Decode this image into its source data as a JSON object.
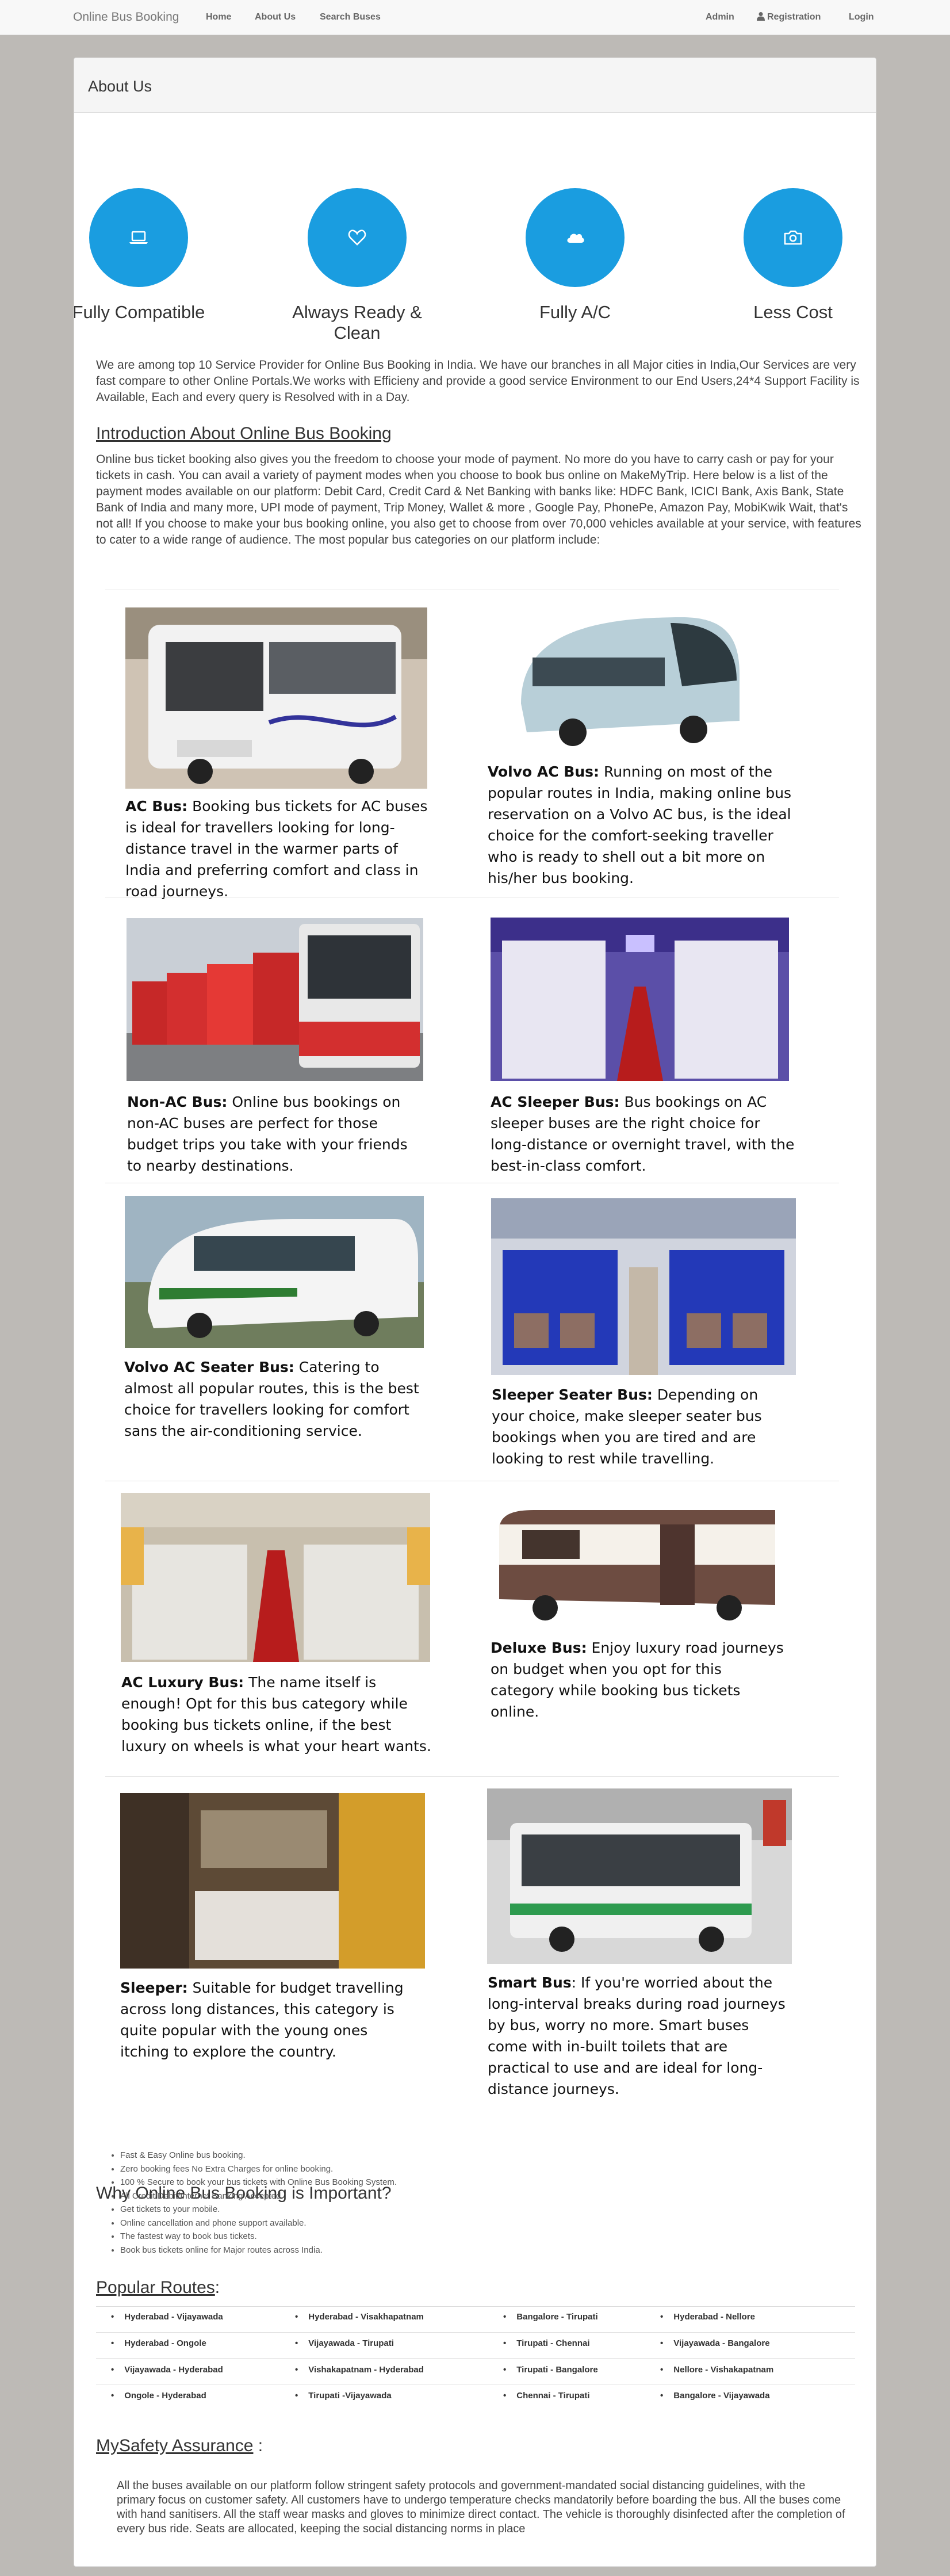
{
  "nav": {
    "brand": "Online Bus Booking",
    "home": "Home",
    "about": "About Us",
    "search": "Search Buses",
    "admin": "Admin",
    "registration": "Registration",
    "login": "Login"
  },
  "panel": {
    "title": "About Us"
  },
  "features": [
    {
      "label": "Fully Compatible",
      "icon": "laptop-icon"
    },
    {
      "label": "Always Ready & Clean",
      "icon": "heart-icon"
    },
    {
      "label": "Fully A/C",
      "icon": "cloud-icon"
    },
    {
      "label": "Less Cost",
      "icon": "camera-icon"
    }
  ],
  "colors": {
    "accent": "#1a9de0",
    "background": "#bdbab6"
  },
  "intro_paragraph": "We are among top 10 Service Provider for Online Bus Booking in India. We have our branches in all Major cities in India,Our Services are very fast compare to other Online Portals.We works with Efficieny and provide a good service Environment to our End Users,24*4 Support Facility is Available, Each and every query is Resolved with in a Day.",
  "introduction": {
    "heading": "Introduction About Online Bus Booking",
    "text": "Online bus ticket booking also gives you the freedom to choose your mode of payment. No more do you have to carry cash or pay for your tickets in cash. You can avail a variety of payment modes when you choose to book bus online on MakeMyTrip. Here below is a list of the payment modes available on our platform: Debit Card, Credit Card & Net Banking with banks like: HDFC Bank, ICICI Bank, Axis Bank, State Bank of India and many more, UPI mode of payment, Trip Money, Wallet & more , Google Pay, PhonePe, Amazon Pay, MobiKwik Wait, that's not all! If you choose to make your bus booking online, you also get to choose from over 70,000 vehicles available at your service, with features to cater to a wide range of audience. The most popular bus categories on our platform include:"
  },
  "buses": [
    {
      "name": "AC Bus:",
      "desc": " Booking bus tickets for AC buses is ideal for travellers looking for long-distance travel in the warmer parts of India and preferring comfort and class in road journeys."
    },
    {
      "name": "Volvo AC Bus:",
      "desc": " Running on most of the popular routes in India, making online bus reservation on a Volvo AC bus, is the ideal choice for the comfort-seeking traveller who is ready to shell out a bit more on his/her bus booking."
    },
    {
      "name": "Non-AC Bus:",
      "desc": " Online bus bookings on non-AC buses are perfect for those budget trips you take with your friends to nearby destinations."
    },
    {
      "name": "AC Sleeper Bus:",
      "desc": " Bus bookings on AC sleeper buses are the right choice for long-distance or overnight travel, with the best-in-class comfort."
    },
    {
      "name": "Volvo AC Seater Bus:",
      "desc": " Catering to almost all popular routes, this is the best choice for travellers looking for comfort sans the air-conditioning service."
    },
    {
      "name": "Sleeper Seater Bus:",
      "desc": " Depending on your choice, make sleeper seater bus bookings when you are tired and are looking to rest while travelling."
    },
    {
      "name": "AC Luxury Bus:",
      "desc": " The name itself is enough! Opt for this bus category while booking bus tickets online, if the best luxury on wheels is what your heart wants."
    },
    {
      "name": "Deluxe Bus:",
      "desc": " Enjoy luxury road journeys on budget when you opt for this category while booking bus tickets online."
    },
    {
      "name": "Sleeper:",
      "desc": " Suitable for budget travelling across long distances, this category is quite popular with the young ones itching to explore the country."
    },
    {
      "name": "Smart Bus",
      "desc": ": If you're worried about the long-interval breaks during road journeys by bus, worry no more. Smart buses come with in-built toilets that are practical to use and are ideal for long-distance journeys."
    }
  ],
  "why": {
    "heading": "Why Online Bus Booking is Important?",
    "items": [
      "Fast & Easy Online bus booking.",
      "Zero booking fees No Extra Charges for online booking.",
      "100 % Secure to book your bus tickets with Online Bus Booking System.",
      "All Credit/Debit/Internet Banking Accepted.",
      "Get tickets to your mobile.",
      "Online cancellation and phone support available.",
      "The fastest way to book bus tickets.",
      "Book bus tickets online for Major routes across India."
    ]
  },
  "routes": {
    "heading": "Popular Routes",
    "colon": ":",
    "rows": [
      [
        "Hyderabad - Vijayawada",
        "Hyderabad - Visakhapatnam",
        "Bangalore - Tirupati",
        "Hyderabad - Nellore"
      ],
      [
        "Hyderabad - Ongole",
        "Vijayawada - Tirupati",
        "Tirupati - Chennai",
        "Vijayawada - Bangalore"
      ],
      [
        "Vijayawada - Hyderabad",
        "Vishakapatnam - Hyderabad",
        "Tirupati - Bangalore",
        "Nellore - Vishakapatnam"
      ],
      [
        "Ongole - Hyderabad",
        "Tirupati -Vijayawada",
        "Chennai - Tirupati",
        "Bangalore - Vijayawada"
      ]
    ]
  },
  "safety": {
    "heading": "MySafety Assurance",
    "colon": " :",
    "text": "All the buses available on our platform follow stringent safety protocols and government-mandated social distancing guidelines, with the primary focus on customer safety. All customers have to undergo temperature checks mandatorily before boarding the bus. All the buses come with hand sanitisers. All the staff wear masks and gloves to minimize direct contact. The vehicle is thoroughly disinfected after the completion of every bus ride. Seats are allocated, keeping the social distancing norms in place"
  }
}
